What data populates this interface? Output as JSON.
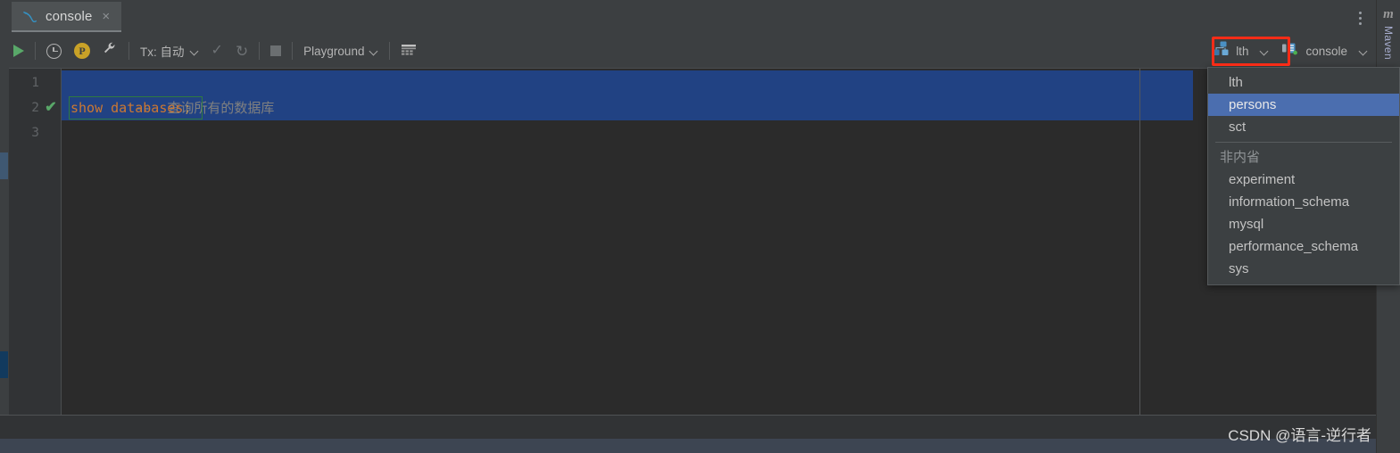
{
  "window": {
    "tab": {
      "label": "console",
      "icon": "mysql-dolphin-icon",
      "close": "×"
    },
    "kebab": "more-options-icon"
  },
  "right_strip": {
    "maven_icon": "m",
    "maven_label": "Maven"
  },
  "toolbar": {
    "run_label": "run-icon",
    "history_label": "history-icon",
    "profile_label": "P",
    "settings_label": "wrench-icon",
    "tx_label": "Tx: 自动",
    "commit_label": "✓",
    "rollback_label": "↺",
    "stop_label": "stop-icon",
    "schema_label": "Playground",
    "table_editor_label": "table-editor-icon",
    "database_label": "lth",
    "console_label": "console"
  },
  "editor": {
    "lines": [
      {
        "num": "1",
        "marker": "",
        "comment": "--  查询所有的数据库",
        "keyword": "",
        "semi": ""
      },
      {
        "num": "2",
        "marker": "✔",
        "comment": "",
        "keyword": "show databases",
        "semi": ";"
      },
      {
        "num": "3",
        "marker": "",
        "comment": "",
        "keyword": "",
        "semi": ""
      }
    ]
  },
  "dropdown": {
    "items": [
      {
        "label": "lth",
        "selected": false
      },
      {
        "label": "persons",
        "selected": true
      },
      {
        "label": "sct",
        "selected": false
      }
    ],
    "group_label": "非内省",
    "group_items": [
      {
        "label": "experiment"
      },
      {
        "label": "information_schema"
      },
      {
        "label": "mysql"
      },
      {
        "label": "performance_schema"
      },
      {
        "label": "sys"
      }
    ]
  },
  "watermark": {
    "text": "CSDN @语言-逆行者"
  },
  "colors": {
    "selection": "#214283",
    "highlight": "#4b6eaf",
    "keyword": "#cc7832",
    "comment": "#808080",
    "accent_red": "#fb2c17",
    "green": "#59a869"
  }
}
